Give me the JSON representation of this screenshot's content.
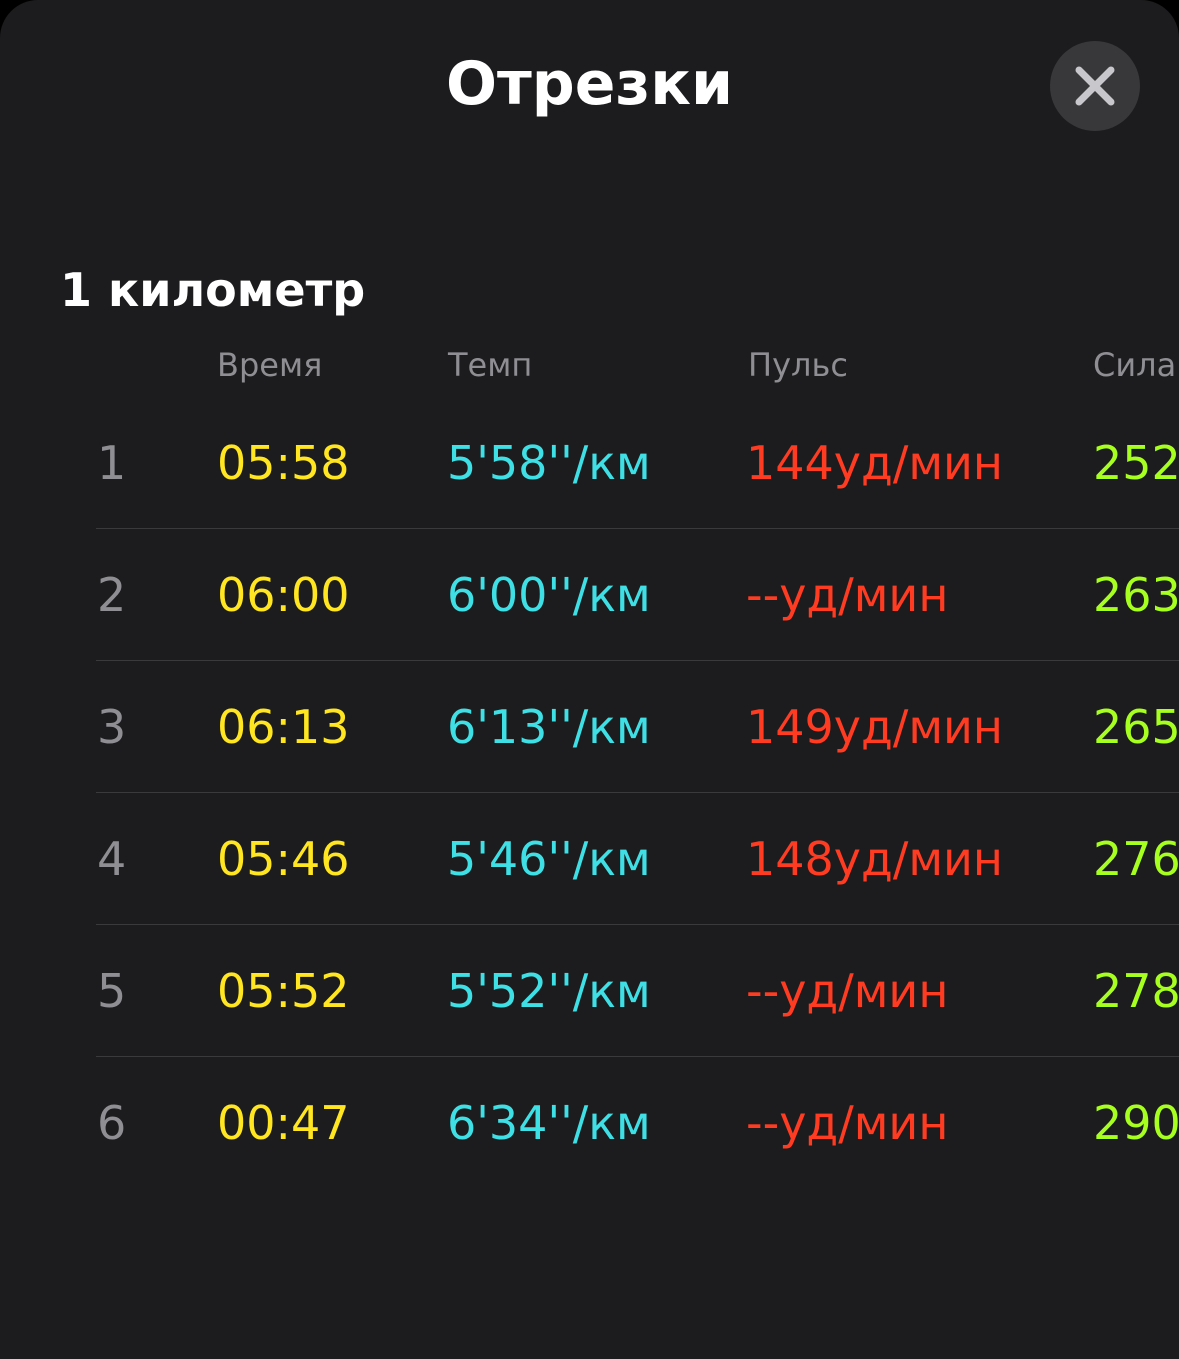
{
  "sheet": {
    "title": "Отрезки",
    "close_icon": "close-icon"
  },
  "section": {
    "title": "1 километр"
  },
  "table": {
    "headers": {
      "time": "Время",
      "pace": "Темп",
      "heart_rate": "Пульс",
      "power": "Сила"
    },
    "rows": [
      {
        "index": "1",
        "time": "05:58",
        "pace": "5'58''/км",
        "heart_rate": "144уд/мин",
        "power": "252"
      },
      {
        "index": "2",
        "time": "06:00",
        "pace": "6'00''/км",
        "heart_rate": "--уд/мин",
        "power": "263"
      },
      {
        "index": "3",
        "time": "06:13",
        "pace": "6'13''/км",
        "heart_rate": "149уд/мин",
        "power": "265"
      },
      {
        "index": "4",
        "time": "05:46",
        "pace": "5'46''/км",
        "heart_rate": "148уд/мин",
        "power": "276"
      },
      {
        "index": "5",
        "time": "05:52",
        "pace": "5'52''/км",
        "heart_rate": "--уд/мин",
        "power": "278"
      },
      {
        "index": "6",
        "time": "00:47",
        "pace": "6'34''/км",
        "heart_rate": "--уд/мин",
        "power": "290"
      }
    ]
  },
  "colors": {
    "background": "#1c1c1e",
    "time": "#ffe620",
    "pace": "#3ee0e6",
    "heart_rate": "#ff3b22",
    "power": "#a6ff1e",
    "secondary_text": "#8e8e93"
  }
}
